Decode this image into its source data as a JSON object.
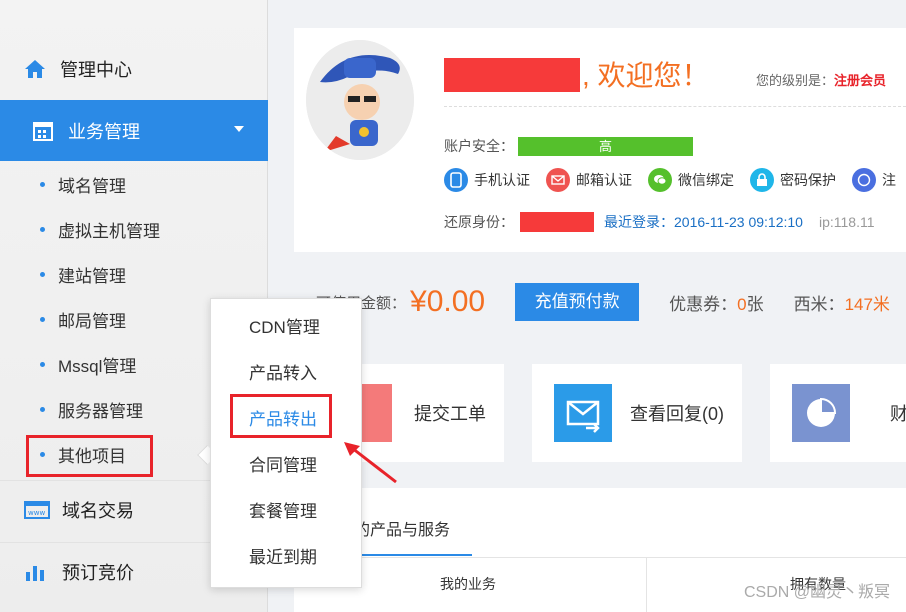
{
  "sidebar": {
    "top_item": "管理中心",
    "active_item": "业务管理",
    "sub_items": [
      "域名管理",
      "虚拟主机管理",
      "建站管理",
      "邮局管理",
      "Mssql管理",
      "服务器管理",
      "其他项目"
    ],
    "bottom_items": [
      "域名交易",
      "预订竞价"
    ]
  },
  "popup": {
    "items": [
      "CDN管理",
      "产品转入",
      "产品转出",
      "合同管理",
      "套餐管理",
      "最近到期"
    ],
    "active_index": 2
  },
  "profile": {
    "welcome": ", 欢迎您！",
    "level_label": "您的级别是：",
    "level_value": "注册会员",
    "security_label": "账户安全：",
    "security_value": "高",
    "auth_items": [
      "手机认证",
      "邮箱认证",
      "微信绑定",
      "密码保护",
      "注"
    ],
    "restore_label": "还原身份：",
    "last_login": "最近登录：2016-11-23 09:12:10",
    "ip": "ip:118.11"
  },
  "balance": {
    "label": "可使用金额：",
    "value": "¥0.00",
    "recharge_button": "充值预付款",
    "coupon_label": "优惠券：",
    "coupon_value": "0",
    "coupon_unit": "张",
    "ximi_label": "西米：",
    "ximi_value": "147米"
  },
  "quick": {
    "ticket": "提交工单",
    "reply": "查看回复(0)",
    "finance": "财"
  },
  "tabs": {
    "active": "的产品与服务"
  },
  "table": {
    "col1": "我的业务",
    "col2": "拥有数量"
  },
  "watermark": "CSDN @幽灵丶叛冥",
  "colors": {
    "accent": "#2b8ae6",
    "highlight": "#e8232a",
    "orange": "#f36f22",
    "security_green": "#55c02c"
  }
}
